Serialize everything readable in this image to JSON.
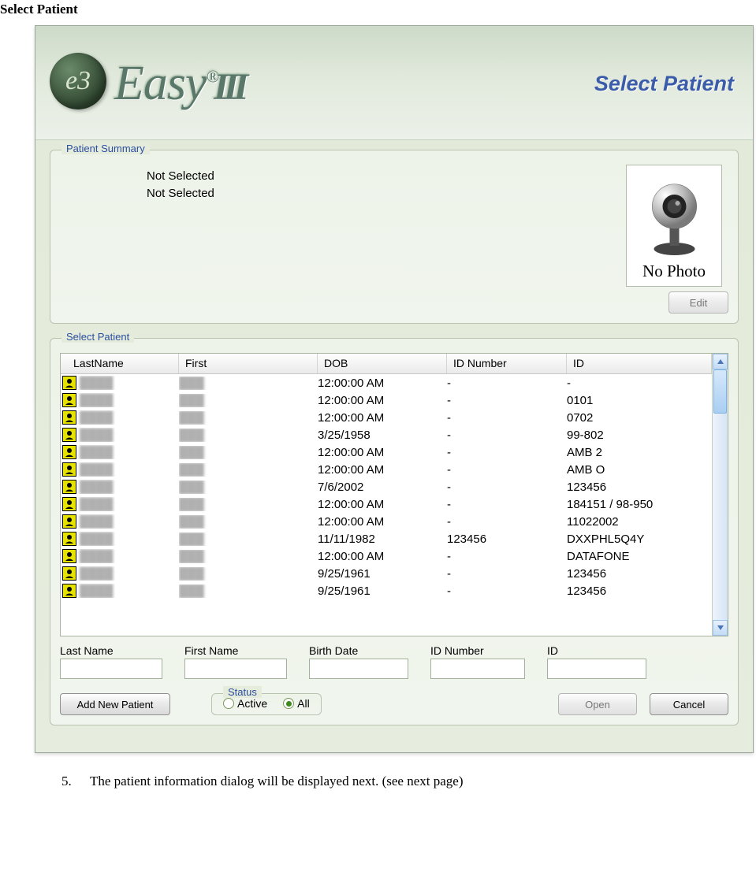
{
  "page_heading": "Select Patient",
  "dialog": {
    "title": "Select Patient",
    "logo_badge": "e3",
    "logo_text_main": "Easy",
    "logo_registered": "®",
    "logo_suffix": "III"
  },
  "patient_summary": {
    "legend": "Patient Summary",
    "line1": "Not Selected",
    "line2": "Not Selected",
    "no_photo_label": "No Photo",
    "edit_button": "Edit"
  },
  "select_patient": {
    "legend": "Select Patient",
    "columns": {
      "last": "LastName",
      "first": "First",
      "dob": "DOB",
      "id_number": "ID Number",
      "id": "ID"
    },
    "rows": [
      {
        "last": "",
        "first": "",
        "dob": "12:00:00 AM",
        "id_number": "-",
        "id": "-"
      },
      {
        "last": "",
        "first": "",
        "dob": "12:00:00 AM",
        "id_number": "-",
        "id": "0101"
      },
      {
        "last": "",
        "first": "",
        "dob": "12:00:00 AM",
        "id_number": "-",
        "id": "0702"
      },
      {
        "last": "",
        "first": "",
        "dob": "3/25/1958",
        "id_number": "-",
        "id": "99-802"
      },
      {
        "last": "",
        "first": "",
        "dob": "12:00:00 AM",
        "id_number": "-",
        "id": "AMB 2"
      },
      {
        "last": "",
        "first": "",
        "dob": "12:00:00 AM",
        "id_number": "-",
        "id": "AMB O"
      },
      {
        "last": "",
        "first": "",
        "dob": "7/6/2002",
        "id_number": "-",
        "id": "123456"
      },
      {
        "last": "",
        "first": "",
        "dob": "12:00:00 AM",
        "id_number": "-",
        "id": "184151  /   98-950"
      },
      {
        "last": "",
        "first": "",
        "dob": "12:00:00 AM",
        "id_number": "-",
        "id": "11022002"
      },
      {
        "last": "",
        "first": "",
        "dob": "11/11/1982",
        "id_number": "123456",
        "id": "DXXPHL5Q4Y"
      },
      {
        "last": "",
        "first": "",
        "dob": "12:00:00 AM",
        "id_number": "-",
        "id": "DATAFONE"
      },
      {
        "last": "",
        "first": "",
        "dob": "9/25/1961",
        "id_number": "-",
        "id": "123456"
      },
      {
        "last": "",
        "first": "",
        "dob": "9/25/1961",
        "id_number": "-",
        "id": "123456"
      }
    ],
    "filter_labels": {
      "last": "Last Name",
      "first": "First Name",
      "dob": "Birth Date",
      "id_number": "ID Number",
      "id": "ID"
    },
    "status": {
      "legend": "Status",
      "active": "Active",
      "all": "All",
      "selected": "all"
    },
    "buttons": {
      "add": "Add New Patient",
      "open": "Open",
      "cancel": "Cancel"
    }
  },
  "footnote": {
    "number": "5.",
    "text": "The patient information dialog will be displayed next. (see next page)"
  }
}
